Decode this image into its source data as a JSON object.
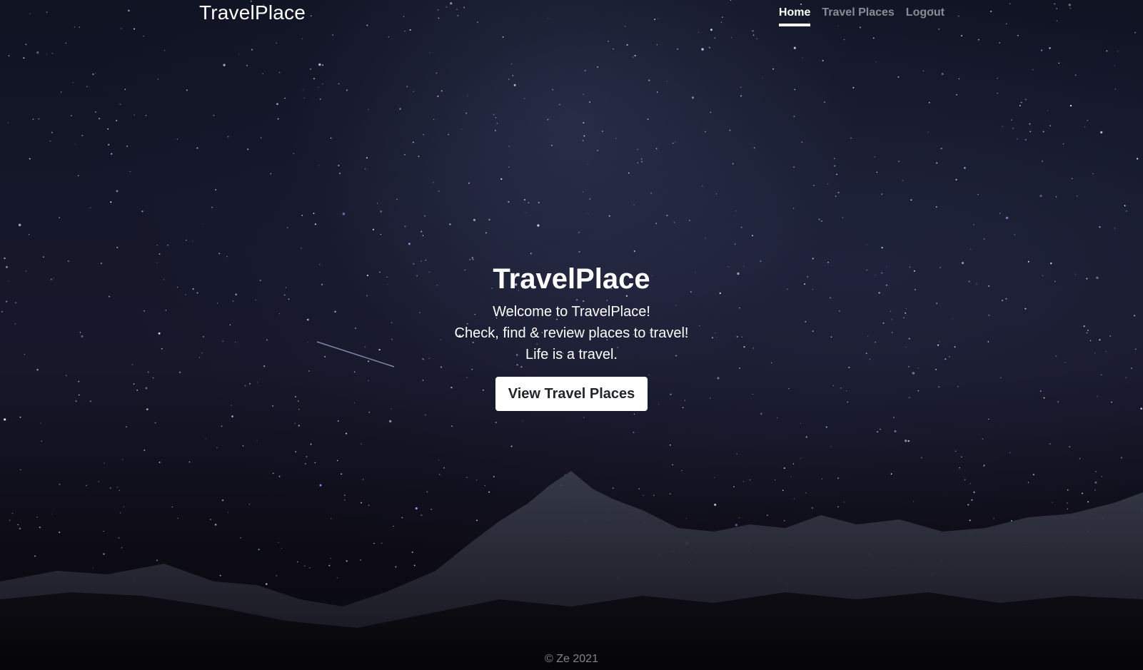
{
  "navbar": {
    "brand": "TravelPlace",
    "links": [
      {
        "label": "Home",
        "active": true
      },
      {
        "label": "Travel Places",
        "active": false
      },
      {
        "label": "Logout",
        "active": false
      }
    ]
  },
  "hero": {
    "title": "TravelPlace",
    "lines": [
      "Welcome to TravelPlace!",
      "Check, find & review places to travel!",
      "Life is a travel."
    ],
    "button_label": "View Travel Places"
  },
  "footer": {
    "text": "© Ze 2021"
  },
  "colors": {
    "background": "#15182a",
    "text": "#ffffff",
    "muted_text": "#8a8a8f",
    "button_bg": "#ffffff",
    "button_text": "#212529"
  }
}
